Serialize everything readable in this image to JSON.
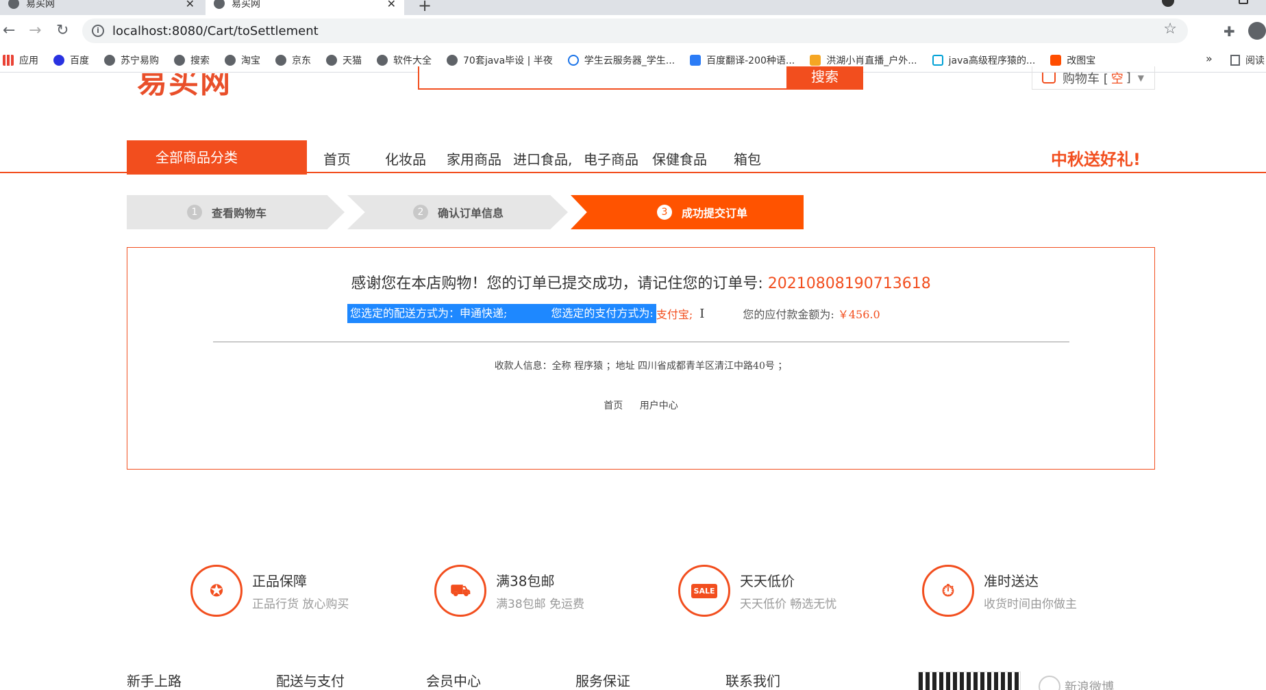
{
  "browser": {
    "tabs": [
      {
        "title": "易买网"
      },
      {
        "title": "易买网"
      }
    ],
    "new_tab": "+",
    "tab_close": "✕",
    "back": "←",
    "forward": "→",
    "reload": "↻",
    "url": "localhost:8080/Cart/toSettlement",
    "star": "☆",
    "extensions": "✚",
    "bookmarks": [
      {
        "label": "应用",
        "icon": "apps-icon"
      },
      {
        "label": "百度",
        "icon": "baidu-icon"
      },
      {
        "label": "苏宁易购",
        "icon": "globe-icon"
      },
      {
        "label": "搜索",
        "icon": "globe-icon"
      },
      {
        "label": "淘宝",
        "icon": "globe-icon"
      },
      {
        "label": "京东",
        "icon": "globe-icon"
      },
      {
        "label": "天猫",
        "icon": "globe-icon"
      },
      {
        "label": "软件大全",
        "icon": "globe-icon"
      },
      {
        "label": "70套java毕设 | 半夜",
        "icon": "globe-icon"
      },
      {
        "label": "学生云服务器_学生...",
        "icon": "cloud-icon"
      },
      {
        "label": "百度翻译-200种语...",
        "icon": "translate-icon"
      },
      {
        "label": "洪湖小肖直播_户外...",
        "icon": "huya-icon"
      },
      {
        "label": "java高级程序猿的...",
        "icon": "bilibili-icon"
      },
      {
        "label": "改图宝",
        "icon": "gaitubao-icon"
      }
    ],
    "bookmarks_more": "»",
    "reading_list": "阅读"
  },
  "header": {
    "logo": "易买网",
    "search_button": "搜索",
    "search_placeholder": "",
    "cart_label": "购物车 [",
    "cart_count": "空",
    "cart_close": "]",
    "cart_arrow": "▼"
  },
  "nav": {
    "all_categories": "全部商品分类",
    "items": [
      "首页",
      "化妆品",
      "家用商品",
      "进口食品,",
      "电子商品",
      "保健食品",
      "箱包"
    ],
    "promo": "中秋送好礼!"
  },
  "steps": [
    {
      "num": "1",
      "label": "查看购物车"
    },
    {
      "num": "2",
      "label": "确认订单信息"
    },
    {
      "num": "3",
      "label": "成功提交订单"
    }
  ],
  "result": {
    "thanks_text": "感谢您在本店购物！您的订单已提交成功，请记住您的订单号: ",
    "order_no": "20210808190713618",
    "shipping_text": "您选定的配送方式为：申通快递;",
    "payment_label": "您选定的支付方式为:",
    "payment_value": "支付宝;",
    "cursor": "I",
    "amount_label": "您的应付款金额为:",
    "amount_value": "￥456.0",
    "receiver": "收款人信息：全称  程序猿 ；地址  四川省成都青羊区清江中路40号 ；",
    "links": [
      "首页",
      "用户中心"
    ]
  },
  "features": [
    {
      "title": "正品保障",
      "sub": "正品行货 放心购买",
      "icon": "badge-icon",
      "glyph": "✪"
    },
    {
      "title": "满38包邮",
      "sub": "满38包邮 免运费",
      "icon": "truck-icon",
      "glyph": "⛟"
    },
    {
      "title": "天天低价",
      "sub": "天天低价 畅选无忧",
      "icon": "sale-icon",
      "glyph": "SALE"
    },
    {
      "title": "准时送达",
      "sub": "收货时间由你做主",
      "icon": "stopwatch-icon",
      "glyph": "⏱"
    }
  ],
  "footer": {
    "columns": [
      "新手上路",
      "配送与支付",
      "会员中心",
      "服务保证",
      "联系我们"
    ],
    "weibo": "新浪微博"
  },
  "colors": {
    "accent": "#f24e1e",
    "step_active": "#ff5300",
    "selection": "#1e88ff"
  }
}
